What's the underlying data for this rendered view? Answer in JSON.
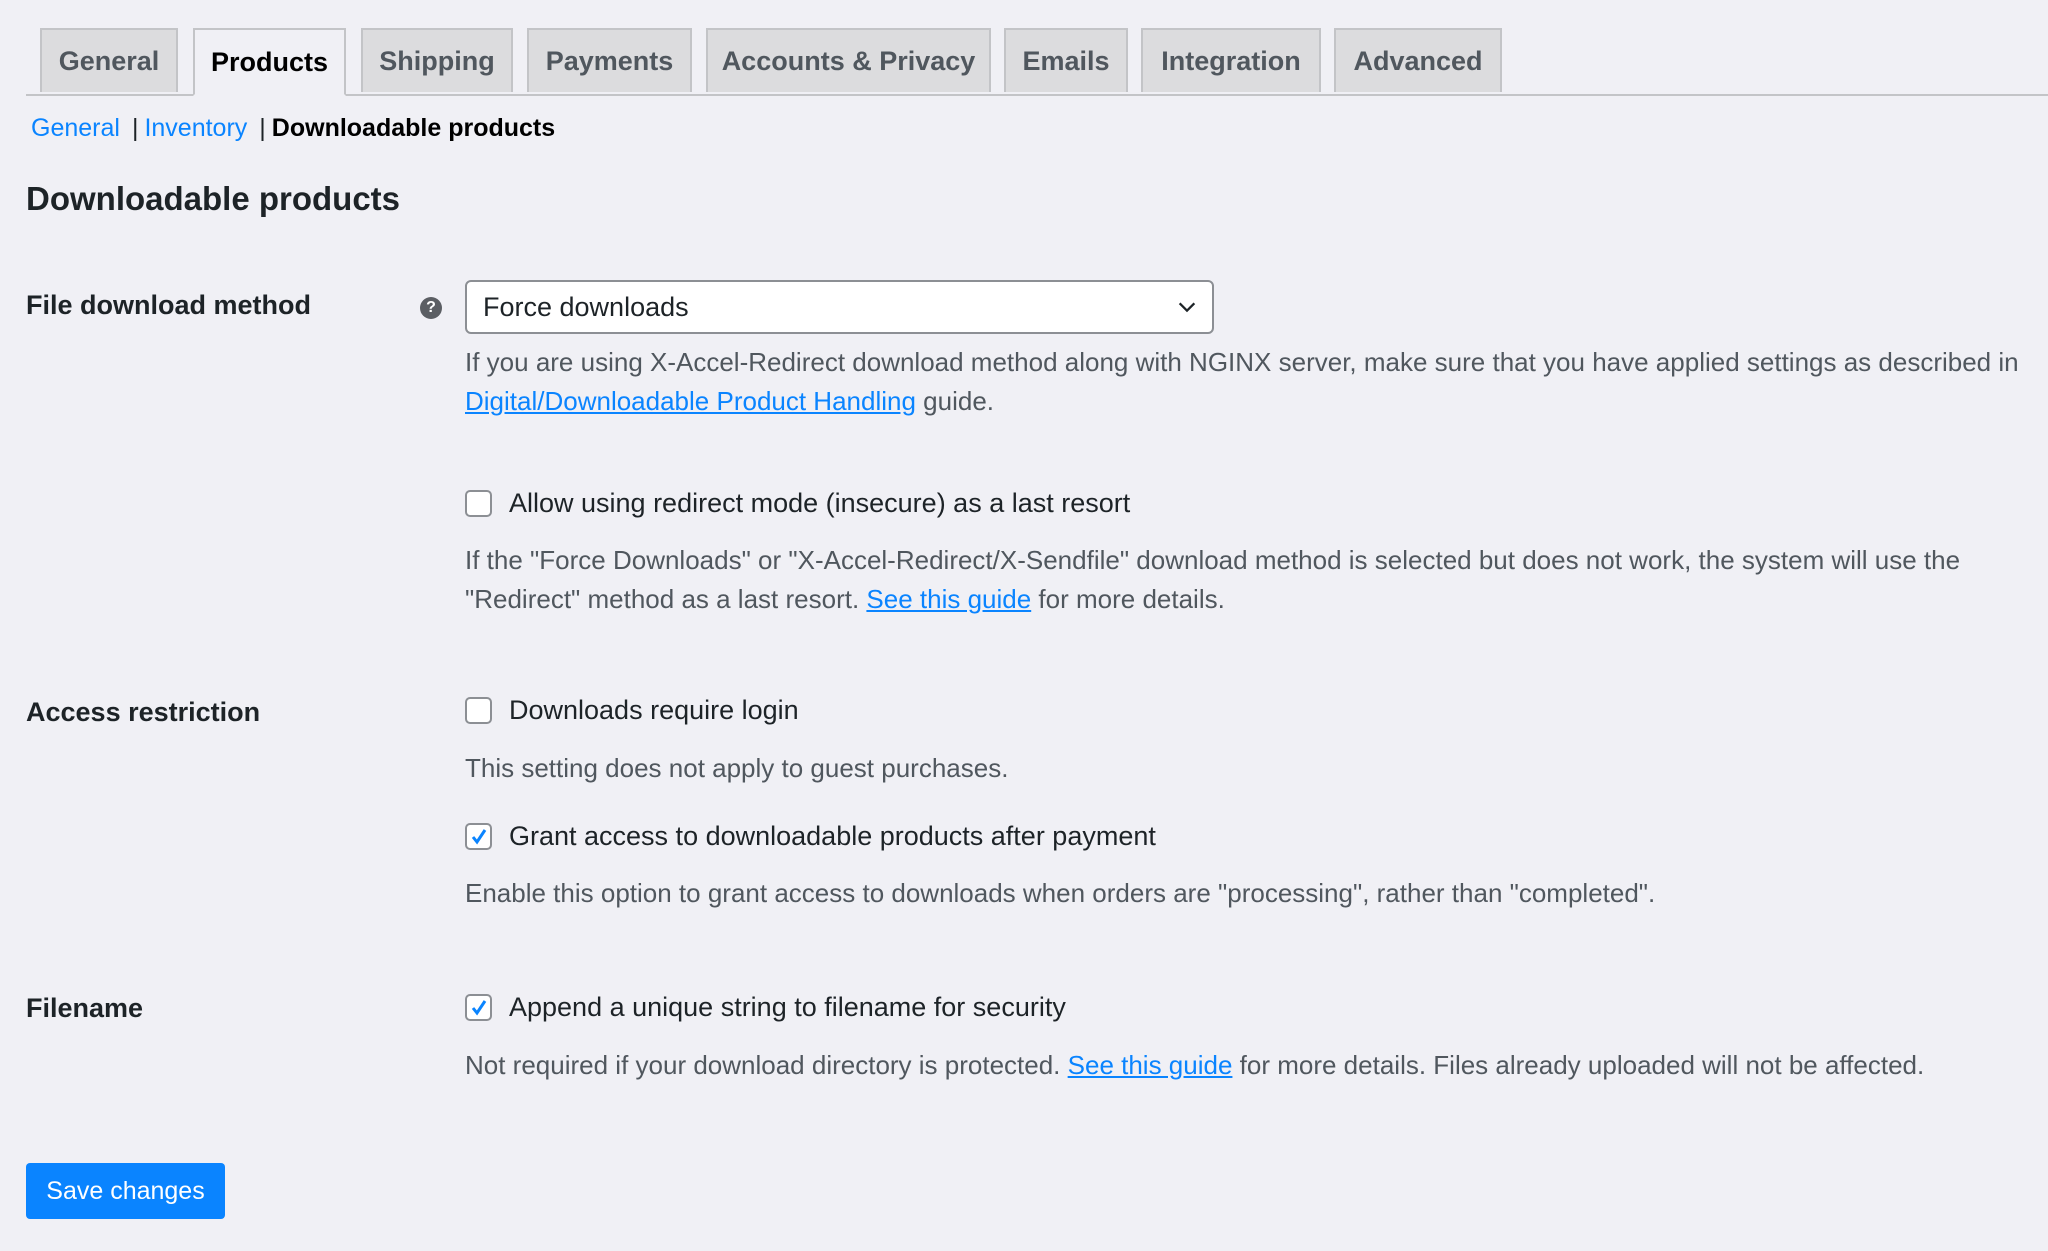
{
  "tabs": [
    {
      "label": "General",
      "active": false
    },
    {
      "label": "Products",
      "active": true
    },
    {
      "label": "Shipping",
      "active": false
    },
    {
      "label": "Payments",
      "active": false
    },
    {
      "label": "Accounts & Privacy",
      "active": false
    },
    {
      "label": "Emails",
      "active": false
    },
    {
      "label": "Integration",
      "active": false
    },
    {
      "label": "Advanced",
      "active": false
    }
  ],
  "subnav": {
    "items": [
      "General",
      "Inventory"
    ],
    "current": "Downloadable products"
  },
  "section_title": "Downloadable products",
  "file_download": {
    "label": "File download method",
    "help_icon": "question-circle-icon",
    "help_glyph": "?",
    "selected": "Force downloads",
    "desc_pre": "If you are using X-Accel-Redirect download method along with NGINX server, make sure that you have applied settings as described in ",
    "desc_link": "Digital/Downloadable Product Handling",
    "desc_post": " guide.",
    "redirect_checkbox": {
      "label": "Allow using redirect mode (insecure) as a last resort",
      "checked": false
    },
    "redirect_desc_pre": "If the \"Force Downloads\" or \"X-Accel-Redirect/X-Sendfile\" download method is selected but does not work, the system will use the \"Redirect\" method as a last resort. ",
    "redirect_desc_link": "See this guide",
    "redirect_desc_post": " for more details."
  },
  "access": {
    "label": "Access restriction",
    "login_checkbox": {
      "label": "Downloads require login",
      "checked": false
    },
    "login_desc": "This setting does not apply to guest purchases.",
    "grant_checkbox": {
      "label": "Grant access to downloadable products after payment",
      "checked": true
    },
    "grant_desc": "Enable this option to grant access to downloads when orders are \"processing\", rather than \"completed\"."
  },
  "filename": {
    "label": "Filename",
    "append_checkbox": {
      "label": "Append a unique string to filename for security",
      "checked": true
    },
    "desc_pre": "Not required if your download directory is protected. ",
    "desc_link": "See this guide",
    "desc_post": " for more details. Files already uploaded will not be affected."
  },
  "save_label": "Save changes",
  "colors": {
    "accent": "#0a84ff",
    "background": "#f0f0f5"
  }
}
